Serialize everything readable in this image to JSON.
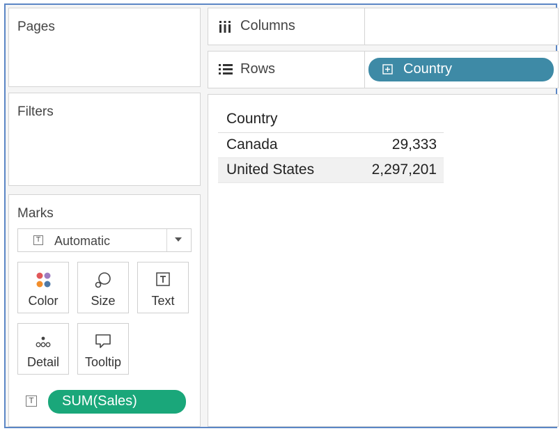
{
  "pages": {
    "title": "Pages"
  },
  "filters": {
    "title": "Filters"
  },
  "marks": {
    "title": "Marks",
    "mark_type": "Automatic",
    "cards": [
      "Color",
      "Size",
      "Text",
      "Detail",
      "Tooltip"
    ],
    "pill": "SUM(Sales)"
  },
  "shelves": {
    "columns_label": "Columns",
    "rows_label": "Rows",
    "rows_pill": "Country"
  },
  "table": {
    "header": "Country",
    "rows": [
      {
        "country": "Canada",
        "value": "29,333"
      },
      {
        "country": "United States",
        "value": "2,297,201"
      }
    ]
  },
  "colors": {
    "frame_border": "#5b86c5",
    "measure_pill": "#1aa77a",
    "dimension_pill": "#3e8aa6"
  }
}
